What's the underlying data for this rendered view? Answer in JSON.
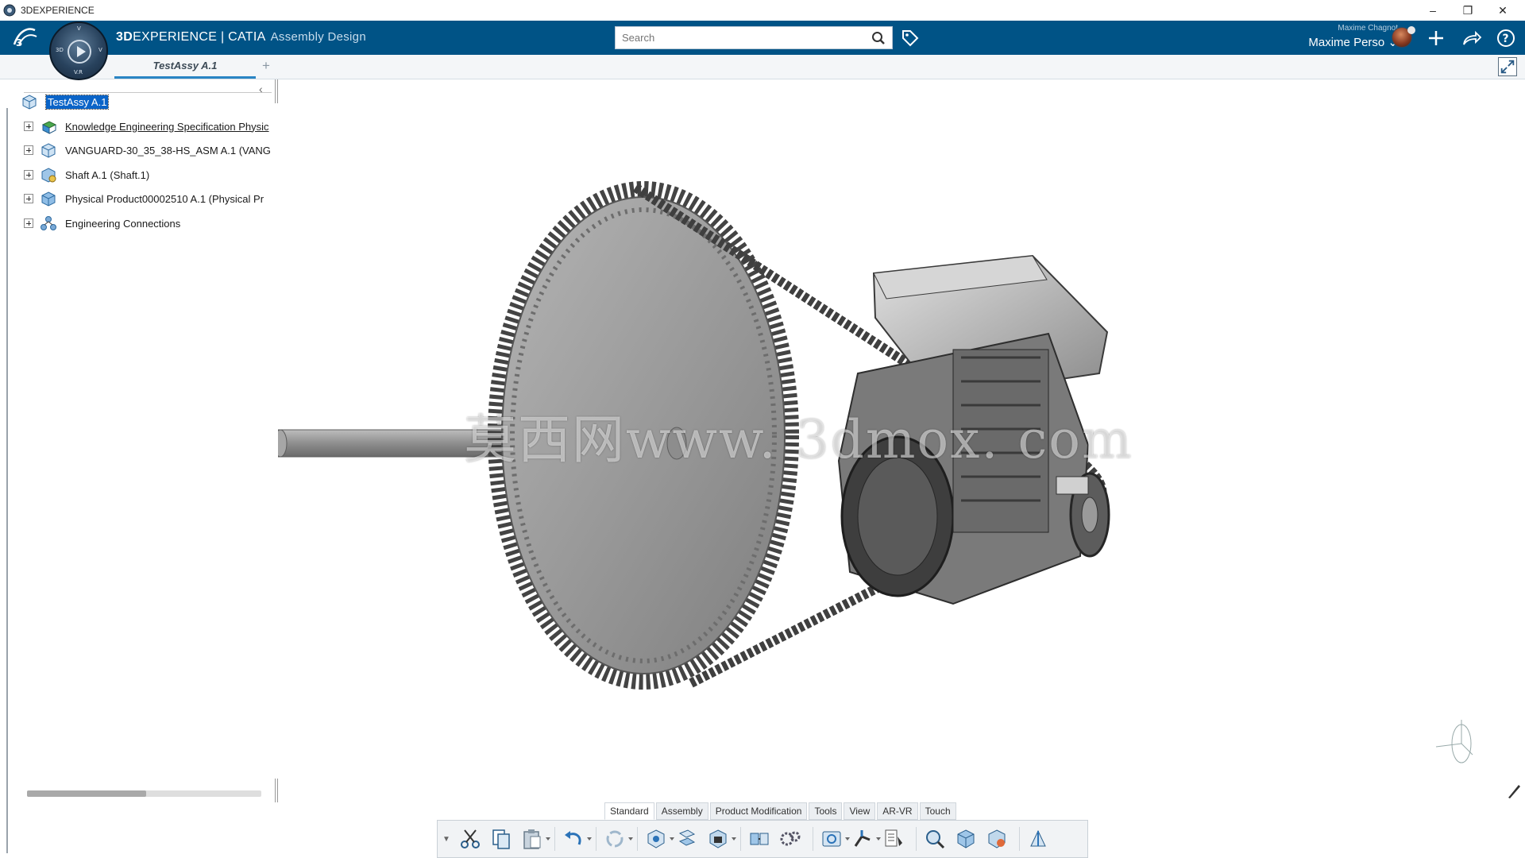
{
  "window": {
    "title": "3DEXPERIENCE",
    "controls": [
      "minimize-icon",
      "restore-icon",
      "close-icon"
    ]
  },
  "header": {
    "brand_part1": "3D",
    "brand_part2": "EXPERIENCE | CATIA",
    "app_name": "Assembly Design",
    "compass_labels": {
      "top": "V",
      "left": "3D",
      "right": "V",
      "bottom": "V.R"
    },
    "search_placeholder": "Search",
    "user_small": "Maxime Chagnot",
    "user_name": "Maxime Perso",
    "icons": [
      "tag-icon",
      "add-icon",
      "share-icon",
      "help-icon"
    ]
  },
  "tabs": {
    "active": "TestAssy A.1",
    "add": "+"
  },
  "tree": {
    "collapse": "‹",
    "root": "TestAssy A.1",
    "nodes": [
      {
        "label": "Knowledge Engineering Specification Physic",
        "underline": true,
        "icon": "kes-icon"
      },
      {
        "label": "VANGUARD-30_35_38-HS_ASM A.1 (VANG",
        "underline": false,
        "icon": "product-icon"
      },
      {
        "label": "Shaft A.1 (Shaft.1)",
        "underline": false,
        "icon": "part-icon"
      },
      {
        "label": "Physical Product00002510 A.1 (Physical Pr",
        "underline": false,
        "icon": "product-icon"
      },
      {
        "label": "Engineering Connections",
        "underline": false,
        "icon": "connections-icon"
      }
    ]
  },
  "viewport": {
    "watermark": "莫西网www. 3dmox. com"
  },
  "action_bar": {
    "tabs": [
      "Standard",
      "Assembly",
      "Product Modification",
      "Tools",
      "View",
      "AR-VR",
      "Touch"
    ],
    "active_tab": "Standard",
    "tools": [
      "cut-icon",
      "copy-icon",
      "paste-icon",
      "undo-icon",
      "update-icon",
      "insert-product-icon",
      "explode-icon",
      "fix-icon",
      "engineering-connection-icon",
      "gear-icon",
      "measure-icon",
      "robot-icon",
      "properties-icon",
      "zoom-fit-icon",
      "snapshot-icon",
      "publish-icon",
      "render-icon"
    ]
  },
  "colors": {
    "header_bg": "#005386",
    "selection": "#0a64c8",
    "tab_accent": "#2a85c4"
  }
}
